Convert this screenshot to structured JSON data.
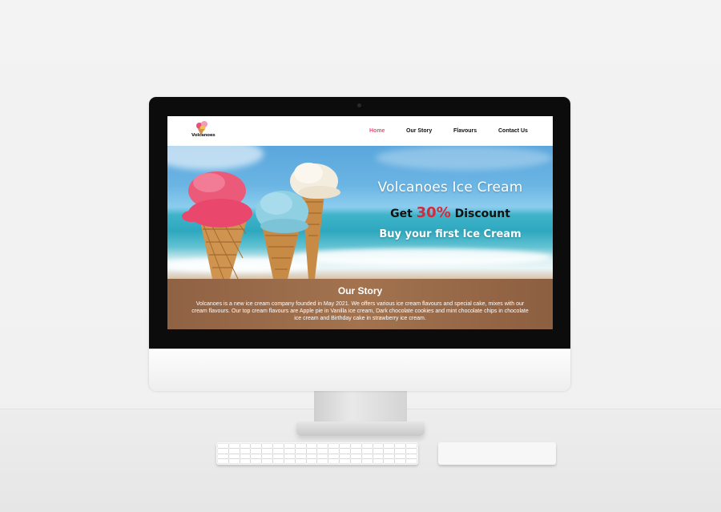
{
  "site": {
    "logo_text": "Volcanoes",
    "nav": {
      "items": [
        "Home",
        "Our Story",
        "Flavours",
        "Contact Us"
      ],
      "active": "Home",
      "active_color": "#e8507a"
    },
    "hero": {
      "title": "Volcanoes Ice Cream",
      "discount_prefix": "Get",
      "discount_value": "30%",
      "discount_suffix": "Discount",
      "subtitle": "Buy your first Ice Cream",
      "accent_color": "#d8283a"
    },
    "story": {
      "heading": "Our Story",
      "body": "Volcanoes is a new ice cream company founded in May 2021. We offers various ice cream flavours and special cake, mixes with our cream flavours. Our top cream flavours are Apple pie in Vanilla ice cream, Dark chocolate cookies and mint chocolate chips in chocolate ice cream and Birthday cake in strawberry ice cream.",
      "bg_color": "#9c6b48"
    }
  }
}
